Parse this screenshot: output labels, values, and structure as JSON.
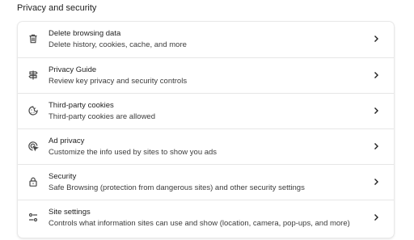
{
  "section": {
    "title": "Privacy and security"
  },
  "items": [
    {
      "title": "Delete browsing data",
      "subtitle": "Delete history, cookies, cache, and more",
      "icon": "trash-icon"
    },
    {
      "title": "Privacy Guide",
      "subtitle": "Review key privacy and security controls",
      "icon": "signpost-icon"
    },
    {
      "title": "Third-party cookies",
      "subtitle": "Third-party cookies are allowed",
      "icon": "cookie-icon"
    },
    {
      "title": "Ad privacy",
      "subtitle": "Customize the info used by sites to show you ads",
      "icon": "ad-target-icon"
    },
    {
      "title": "Security",
      "subtitle": "Safe Browsing (protection from dangerous sites) and other security settings",
      "icon": "lock-icon"
    },
    {
      "title": "Site settings",
      "subtitle": "Controls what information sites can use and show (location, camera, pop-ups, and more)",
      "icon": "sliders-icon"
    }
  ],
  "colors": {
    "text_primary": "#1f1f1f",
    "text_secondary": "#3c3c3c",
    "icon": "#474747",
    "divider": "#e6e6e6"
  }
}
